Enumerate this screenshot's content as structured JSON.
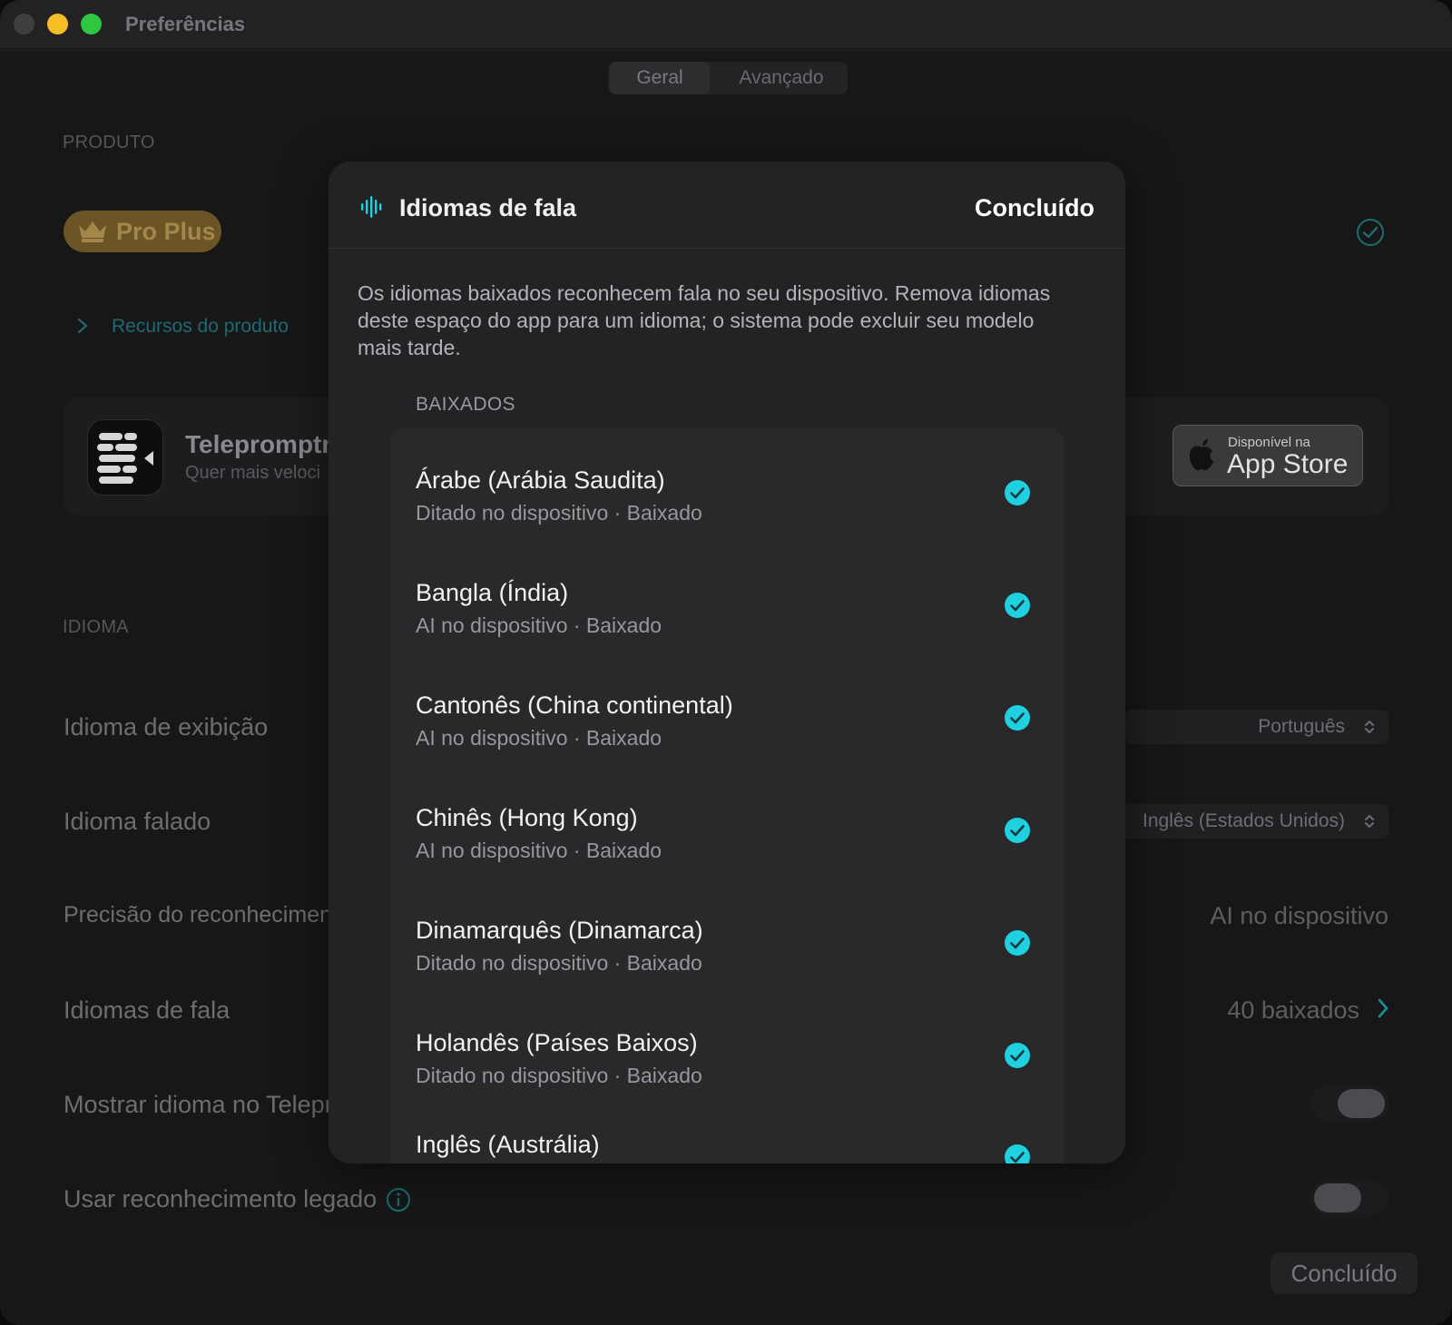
{
  "window": {
    "title": "Preferências"
  },
  "tabs": [
    {
      "label": "Geral"
    },
    {
      "label": "Avançado"
    }
  ],
  "product": {
    "section_label": "PRODUTO",
    "badge": "Pro Plus",
    "resources_link": "Recursos do produto",
    "promo_title": "Telepromptm",
    "promo_subtitle": "Quer mais veloci",
    "appstore_small": "Disponível na",
    "appstore_big": "App Store"
  },
  "language": {
    "section_label": "IDIOMA",
    "rows": {
      "display_language": {
        "label": "Idioma de exibição",
        "value": "Português"
      },
      "spoken_language": {
        "label": "Idioma falado",
        "value": "Inglês (Estados Unidos)"
      },
      "recognition_precision": {
        "label": "Precisão do reconheciment",
        "value": "AI no dispositivo"
      },
      "speech_languages": {
        "label": "Idiomas de fala",
        "value": "40 baixados"
      },
      "show_language": {
        "label": "Mostrar idioma no Telepr"
      },
      "legacy_recognition": {
        "label": "Usar reconhecimento legado"
      }
    },
    "done_button": "Concluído"
  },
  "modal": {
    "title": "Idiomas de fala",
    "done": "Concluído",
    "description": "Os idiomas baixados reconhecem fala no seu dispositivo. Remova idiomas deste espaço do app para um idioma; o sistema pode excluir seu modelo mais tarde.",
    "list_label": "BAIXADOS",
    "items": [
      {
        "name": "Árabe (Arábia Saudita)",
        "meta": "Ditado no dispositivo · Baixado"
      },
      {
        "name": "Bangla (Índia)",
        "meta": "AI no dispositivo · Baixado"
      },
      {
        "name": "Cantonês (China continental)",
        "meta": "AI no dispositivo · Baixado"
      },
      {
        "name": "Chinês (Hong Kong)",
        "meta": "AI no dispositivo · Baixado"
      },
      {
        "name": "Dinamarquês (Dinamarca)",
        "meta": "Ditado no dispositivo · Baixado"
      },
      {
        "name": "Holandês (Países Baixos)",
        "meta": "Ditado no dispositivo · Baixado"
      },
      {
        "name": "Inglês (Austrália)",
        "meta": ""
      }
    ]
  },
  "colors": {
    "accent": "#1fd0e0",
    "link": "#1f6a72",
    "badge": "#6b5426"
  },
  "icons": [
    "crown-icon",
    "check-circle-icon",
    "chevron-right-icon",
    "apple-icon",
    "updown-chevron-icon",
    "info-icon",
    "waveform-icon",
    "checkmark-filled-icon"
  ]
}
